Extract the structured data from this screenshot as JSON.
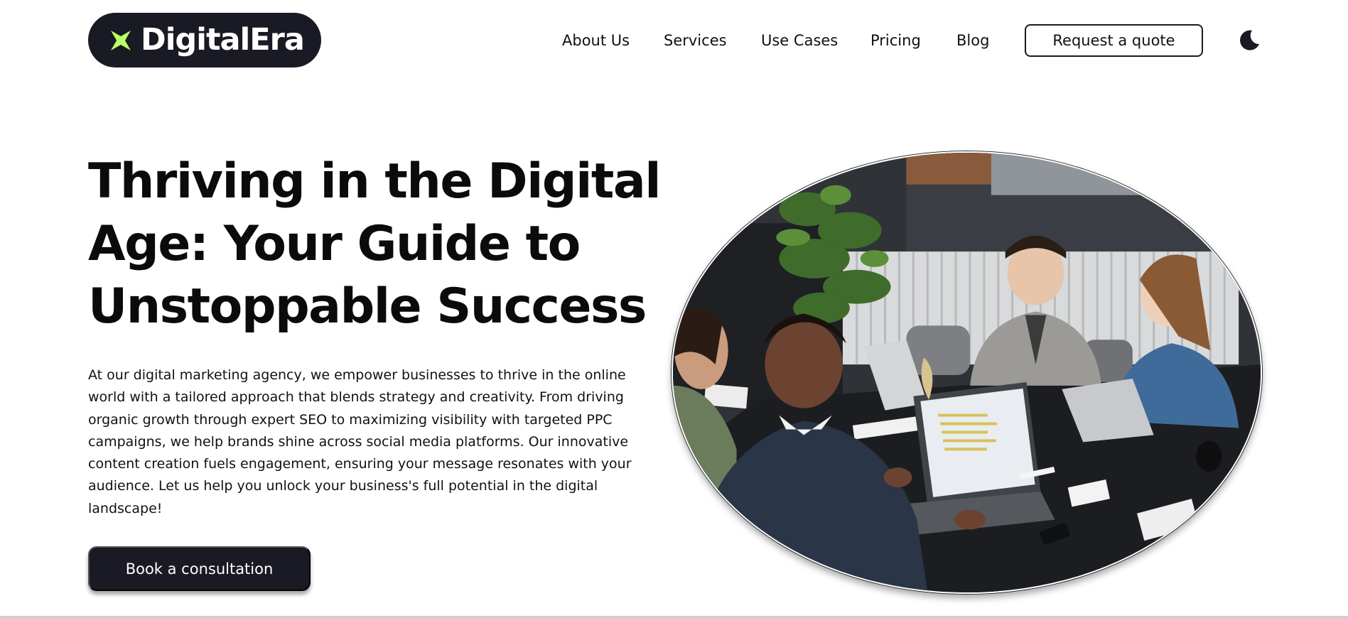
{
  "brand": {
    "name": "DigitalEra",
    "accent_color": "#b9ff66",
    "dark_color": "#191a23",
    "logo_icon": "four-point-star-icon"
  },
  "nav": {
    "links": [
      "About Us",
      "Services",
      "Use Cases",
      "Pricing",
      "Blog"
    ],
    "quote_label": "Request a quote",
    "theme_toggle_icon": "moon-icon"
  },
  "hero": {
    "title": "Thriving in the Digital Age: Your Guide to Unstoppable Success",
    "description": "At our digital marketing agency, we empower businesses to thrive in the online world with a tailored approach that blends strategy and creativity. From driving organic growth through expert SEO to maximizing visibility with targeted PPC campaigns, we help brands shine across social media platforms. Our innovative content creation fuels engagement, ensuring your message resonates with your audience. Let us help you unlock your business's full potential in the digital landscape!",
    "cta_label": "Book a consultation"
  }
}
